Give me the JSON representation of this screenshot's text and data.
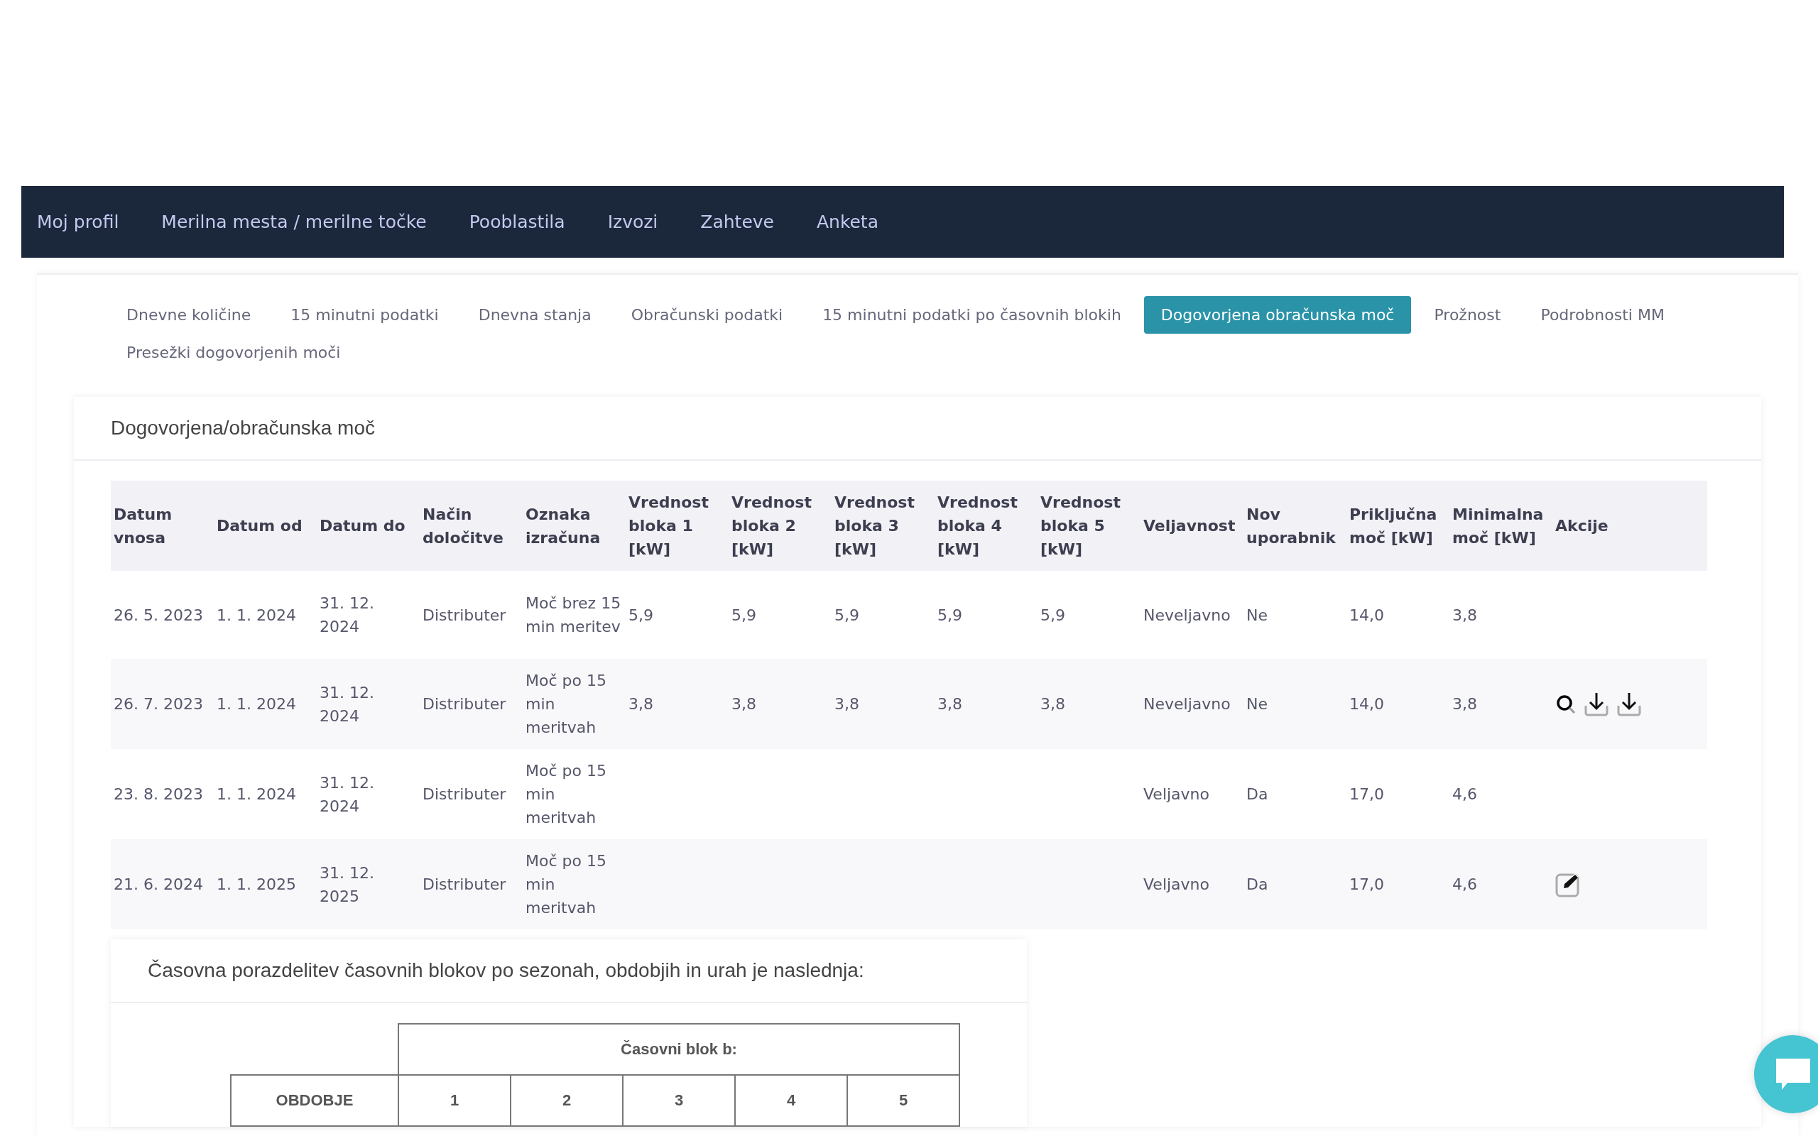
{
  "nav": [
    {
      "label": "Moj profil"
    },
    {
      "label": "Merilna mesta / merilne točke"
    },
    {
      "label": "Pooblastila"
    },
    {
      "label": "Izvozi"
    },
    {
      "label": "Zahteve"
    },
    {
      "label": "Anketa"
    }
  ],
  "tabs": [
    {
      "label": "Dnevne količine",
      "selected": false
    },
    {
      "label": "15 minutni podatki",
      "selected": false
    },
    {
      "label": "Dnevna stanja",
      "selected": false
    },
    {
      "label": "Obračunski podatki",
      "selected": false
    },
    {
      "label": "15 minutni podatki po časovnih blokih",
      "selected": false
    },
    {
      "label": "Dogovorjena obračunska moč",
      "selected": true
    },
    {
      "label": "Prožnost",
      "selected": false
    },
    {
      "label": "Podrobnosti MM",
      "selected": false
    },
    {
      "label": "Presežki dogovorjenih moči",
      "selected": false
    }
  ],
  "panel": {
    "title": "Dogovorjena/obračunska moč",
    "table": {
      "columns": [
        "Datum vnosa",
        "Datum od",
        "Datum do",
        "Način določitve",
        "Oznaka izračuna",
        "Vrednost bloka 1 [kW]",
        "Vrednost bloka 2 [kW]",
        "Vrednost bloka 3 [kW]",
        "Vrednost bloka 4 [kW]",
        "Vrednost bloka 5 [kW]",
        "Veljavnost",
        "Nov uporabnik",
        "Priključna moč [kW]",
        "Minimalna moč [kW]",
        "Akcije"
      ],
      "rows": [
        {
          "cells": [
            "26. 5. 2023",
            "1. 1. 2024",
            "31. 12. 2024",
            "Distributer",
            "Moč brez 15 min meritev",
            "5,9",
            "5,9",
            "5,9",
            "5,9",
            "5,9",
            "Neveljavno",
            "Ne",
            "14,0",
            "3,8"
          ],
          "actions": []
        },
        {
          "cells": [
            "26. 7. 2023",
            "1. 1. 2024",
            "31. 12. 2024",
            "Distributer",
            "Moč po 15 min meritvah",
            "3,8",
            "3,8",
            "3,8",
            "3,8",
            "3,8",
            "Neveljavno",
            "Ne",
            "14,0",
            "3,8"
          ],
          "actions": [
            {
              "kind": "search"
            },
            {
              "kind": "download"
            },
            {
              "kind": "download"
            }
          ]
        },
        {
          "cells": [
            "23. 8. 2023",
            "1. 1. 2024",
            "31. 12. 2024",
            "Distributer",
            "Moč po 15 min meritvah",
            "",
            "",
            "",
            "",
            "",
            "Veljavno",
            "Da",
            "17,0",
            "4,6"
          ],
          "actions": []
        },
        {
          "cells": [
            "21. 6. 2024",
            "1. 1. 2025",
            "31. 12. 2025",
            "Distributer",
            "Moč po 15 min meritvah",
            "",
            "",
            "",
            "",
            "",
            "Veljavno",
            "Da",
            "17,0",
            "4,6"
          ],
          "actions": [
            {
              "kind": "edit"
            }
          ]
        }
      ]
    }
  },
  "blocks": {
    "title": "Časovna porazdelitev časovnih blokov po sezonah, obdobjih in urah je naslednja:",
    "group_header": "Časovni blok b:",
    "period_header": "OBDOBJE",
    "block_numbers": [
      "1",
      "2",
      "3",
      "4",
      "5"
    ]
  }
}
